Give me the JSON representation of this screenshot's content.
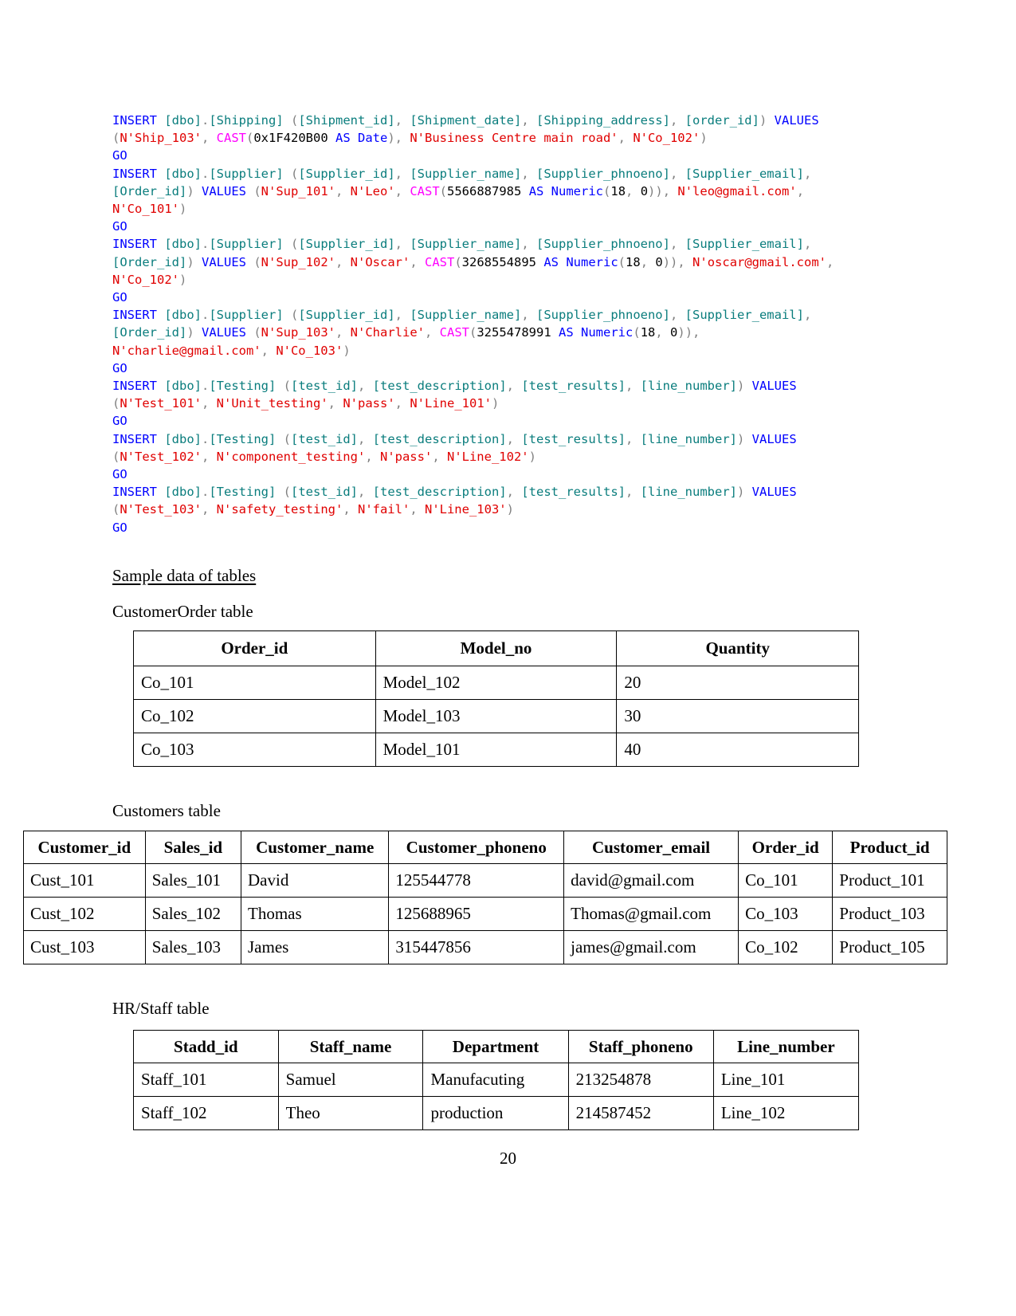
{
  "document": {
    "page_number": "20"
  },
  "sql": {
    "statements": [
      {
        "tokens": [
          {
            "t": "INSERT ",
            "c": "k"
          },
          {
            "t": "[dbo]",
            "c": "id"
          },
          {
            "t": ".",
            "c": "p"
          },
          {
            "t": "[Shipping]",
            "c": "id"
          },
          {
            "t": " (",
            "c": "p"
          },
          {
            "t": "[Shipment_id]",
            "c": "id"
          },
          {
            "t": ", ",
            "c": "p"
          },
          {
            "t": "[Shipment_date]",
            "c": "id"
          },
          {
            "t": ", ",
            "c": "p"
          },
          {
            "t": "[Shipping_address]",
            "c": "id"
          },
          {
            "t": ", ",
            "c": "p"
          },
          {
            "t": "[order_id]",
            "c": "id"
          },
          {
            "t": ") ",
            "c": "p"
          },
          {
            "t": "VALUES",
            "c": "k"
          },
          {
            "t": " (",
            "c": "p"
          },
          {
            "t": "N'Ship_103'",
            "c": "s"
          },
          {
            "t": ", ",
            "c": "p"
          },
          {
            "t": "CAST",
            "c": "f"
          },
          {
            "t": "(",
            "c": "p"
          },
          {
            "t": "0x1F420B00",
            "c": "n"
          },
          {
            "t": " ",
            "c": "p"
          },
          {
            "t": "AS Date",
            "c": "k"
          },
          {
            "t": "), ",
            "c": "p"
          },
          {
            "t": "N'Business Centre main road'",
            "c": "s"
          },
          {
            "t": ", ",
            "c": "p"
          },
          {
            "t": "N'Co_102'",
            "c": "s"
          },
          {
            "t": ")",
            "c": "p"
          }
        ]
      },
      {
        "tokens": [
          {
            "t": "INSERT ",
            "c": "k"
          },
          {
            "t": "[dbo]",
            "c": "id"
          },
          {
            "t": ".",
            "c": "p"
          },
          {
            "t": "[Supplier]",
            "c": "id"
          },
          {
            "t": " (",
            "c": "p"
          },
          {
            "t": "[Supplier_id]",
            "c": "id"
          },
          {
            "t": ", ",
            "c": "p"
          },
          {
            "t": "[Supplier_name]",
            "c": "id"
          },
          {
            "t": ", ",
            "c": "p"
          },
          {
            "t": "[Supplier_phnoeno]",
            "c": "id"
          },
          {
            "t": ", ",
            "c": "p"
          },
          {
            "t": "[Supplier_email]",
            "c": "id"
          },
          {
            "t": ", ",
            "c": "p"
          },
          {
            "t": "[Order_id]",
            "c": "id"
          },
          {
            "t": ") ",
            "c": "p"
          },
          {
            "t": "VALUES",
            "c": "k"
          },
          {
            "t": " (",
            "c": "p"
          },
          {
            "t": "N'Sup_101'",
            "c": "s"
          },
          {
            "t": ", ",
            "c": "p"
          },
          {
            "t": "N'Leo'",
            "c": "s"
          },
          {
            "t": ", ",
            "c": "p"
          },
          {
            "t": "CAST",
            "c": "f"
          },
          {
            "t": "(",
            "c": "p"
          },
          {
            "t": "5566887985",
            "c": "n"
          },
          {
            "t": " ",
            "c": "p"
          },
          {
            "t": "AS Numeric",
            "c": "k"
          },
          {
            "t": "(",
            "c": "p"
          },
          {
            "t": "18",
            "c": "n"
          },
          {
            "t": ", ",
            "c": "p"
          },
          {
            "t": "0",
            "c": "n"
          },
          {
            "t": ")), ",
            "c": "p"
          },
          {
            "t": "N'leo@gmail.com'",
            "c": "s"
          },
          {
            "t": ", ",
            "c": "p"
          },
          {
            "t": "N'Co_101'",
            "c": "s"
          },
          {
            "t": ")",
            "c": "p"
          }
        ]
      },
      {
        "tokens": [
          {
            "t": "INSERT ",
            "c": "k"
          },
          {
            "t": "[dbo]",
            "c": "id"
          },
          {
            "t": ".",
            "c": "p"
          },
          {
            "t": "[Supplier]",
            "c": "id"
          },
          {
            "t": " (",
            "c": "p"
          },
          {
            "t": "[Supplier_id]",
            "c": "id"
          },
          {
            "t": ", ",
            "c": "p"
          },
          {
            "t": "[Supplier_name]",
            "c": "id"
          },
          {
            "t": ", ",
            "c": "p"
          },
          {
            "t": "[Supplier_phnoeno]",
            "c": "id"
          },
          {
            "t": ", ",
            "c": "p"
          },
          {
            "t": "[Supplier_email]",
            "c": "id"
          },
          {
            "t": ", ",
            "c": "p"
          },
          {
            "t": "[Order_id]",
            "c": "id"
          },
          {
            "t": ") ",
            "c": "p"
          },
          {
            "t": "VALUES",
            "c": "k"
          },
          {
            "t": " (",
            "c": "p"
          },
          {
            "t": "N'Sup_102'",
            "c": "s"
          },
          {
            "t": ", ",
            "c": "p"
          },
          {
            "t": "N'Oscar'",
            "c": "s"
          },
          {
            "t": ", ",
            "c": "p"
          },
          {
            "t": "CAST",
            "c": "f"
          },
          {
            "t": "(",
            "c": "p"
          },
          {
            "t": "3268554895",
            "c": "n"
          },
          {
            "t": " ",
            "c": "p"
          },
          {
            "t": "AS Numeric",
            "c": "k"
          },
          {
            "t": "(",
            "c": "p"
          },
          {
            "t": "18",
            "c": "n"
          },
          {
            "t": ", ",
            "c": "p"
          },
          {
            "t": "0",
            "c": "n"
          },
          {
            "t": ")), ",
            "c": "p"
          },
          {
            "t": "N'oscar@gmail.com'",
            "c": "s"
          },
          {
            "t": ", ",
            "c": "p"
          },
          {
            "t": "N'Co_102'",
            "c": "s"
          },
          {
            "t": ")",
            "c": "p"
          }
        ]
      },
      {
        "tokens": [
          {
            "t": "INSERT ",
            "c": "k"
          },
          {
            "t": "[dbo]",
            "c": "id"
          },
          {
            "t": ".",
            "c": "p"
          },
          {
            "t": "[Supplier]",
            "c": "id"
          },
          {
            "t": " (",
            "c": "p"
          },
          {
            "t": "[Supplier_id]",
            "c": "id"
          },
          {
            "t": ", ",
            "c": "p"
          },
          {
            "t": "[Supplier_name]",
            "c": "id"
          },
          {
            "t": ", ",
            "c": "p"
          },
          {
            "t": "[Supplier_phnoeno]",
            "c": "id"
          },
          {
            "t": ", ",
            "c": "p"
          },
          {
            "t": "[Supplier_email]",
            "c": "id"
          },
          {
            "t": ", ",
            "c": "p"
          },
          {
            "t": "[Order_id]",
            "c": "id"
          },
          {
            "t": ") ",
            "c": "p"
          },
          {
            "t": "VALUES",
            "c": "k"
          },
          {
            "t": " (",
            "c": "p"
          },
          {
            "t": "N'Sup_103'",
            "c": "s"
          },
          {
            "t": ", ",
            "c": "p"
          },
          {
            "t": "N'Charlie'",
            "c": "s"
          },
          {
            "t": ", ",
            "c": "p"
          },
          {
            "t": "CAST",
            "c": "f"
          },
          {
            "t": "(",
            "c": "p"
          },
          {
            "t": "3255478991",
            "c": "n"
          },
          {
            "t": " ",
            "c": "p"
          },
          {
            "t": "AS Numeric",
            "c": "k"
          },
          {
            "t": "(",
            "c": "p"
          },
          {
            "t": "18",
            "c": "n"
          },
          {
            "t": ", ",
            "c": "p"
          },
          {
            "t": "0",
            "c": "n"
          },
          {
            "t": ")), ",
            "c": "p"
          },
          {
            "t": "N'charlie@gmail.com'",
            "c": "s"
          },
          {
            "t": ", ",
            "c": "p"
          },
          {
            "t": "N'Co_103'",
            "c": "s"
          },
          {
            "t": ")",
            "c": "p"
          }
        ]
      },
      {
        "tokens": [
          {
            "t": "INSERT ",
            "c": "k"
          },
          {
            "t": "[dbo]",
            "c": "id"
          },
          {
            "t": ".",
            "c": "p"
          },
          {
            "t": "[Testing]",
            "c": "id"
          },
          {
            "t": " (",
            "c": "p"
          },
          {
            "t": "[test_id]",
            "c": "id"
          },
          {
            "t": ", ",
            "c": "p"
          },
          {
            "t": "[test_description]",
            "c": "id"
          },
          {
            "t": ", ",
            "c": "p"
          },
          {
            "t": "[test_results]",
            "c": "id"
          },
          {
            "t": ", ",
            "c": "p"
          },
          {
            "t": "[line_number]",
            "c": "id"
          },
          {
            "t": ") ",
            "c": "p"
          },
          {
            "t": "VALUES",
            "c": "k"
          },
          {
            "t": " (",
            "c": "p"
          },
          {
            "t": "N'Test_101'",
            "c": "s"
          },
          {
            "t": ", ",
            "c": "p"
          },
          {
            "t": "N'Unit_testing'",
            "c": "s"
          },
          {
            "t": ", ",
            "c": "p"
          },
          {
            "t": "N'pass'",
            "c": "s"
          },
          {
            "t": ", ",
            "c": "p"
          },
          {
            "t": "N'Line_101'",
            "c": "s"
          },
          {
            "t": ")",
            "c": "p"
          }
        ]
      },
      {
        "tokens": [
          {
            "t": "INSERT ",
            "c": "k"
          },
          {
            "t": "[dbo]",
            "c": "id"
          },
          {
            "t": ".",
            "c": "p"
          },
          {
            "t": "[Testing]",
            "c": "id"
          },
          {
            "t": " (",
            "c": "p"
          },
          {
            "t": "[test_id]",
            "c": "id"
          },
          {
            "t": ", ",
            "c": "p"
          },
          {
            "t": "[test_description]",
            "c": "id"
          },
          {
            "t": ", ",
            "c": "p"
          },
          {
            "t": "[test_results]",
            "c": "id"
          },
          {
            "t": ", ",
            "c": "p"
          },
          {
            "t": "[line_number]",
            "c": "id"
          },
          {
            "t": ") ",
            "c": "p"
          },
          {
            "t": "VALUES",
            "c": "k"
          },
          {
            "t": " (",
            "c": "p"
          },
          {
            "t": "N'Test_102'",
            "c": "s"
          },
          {
            "t": ", ",
            "c": "p"
          },
          {
            "t": "N'component_testing'",
            "c": "s"
          },
          {
            "t": ", ",
            "c": "p"
          },
          {
            "t": "N'pass'",
            "c": "s"
          },
          {
            "t": ", ",
            "c": "p"
          },
          {
            "t": "N'Line_102'",
            "c": "s"
          },
          {
            "t": ")",
            "c": "p"
          }
        ]
      },
      {
        "tokens": [
          {
            "t": "INSERT ",
            "c": "k"
          },
          {
            "t": "[dbo]",
            "c": "id"
          },
          {
            "t": ".",
            "c": "p"
          },
          {
            "t": "[Testing]",
            "c": "id"
          },
          {
            "t": " (",
            "c": "p"
          },
          {
            "t": "[test_id]",
            "c": "id"
          },
          {
            "t": ", ",
            "c": "p"
          },
          {
            "t": "[test_description]",
            "c": "id"
          },
          {
            "t": ", ",
            "c": "p"
          },
          {
            "t": "[test_results]",
            "c": "id"
          },
          {
            "t": ", ",
            "c": "p"
          },
          {
            "t": "[line_number]",
            "c": "id"
          },
          {
            "t": ") ",
            "c": "p"
          },
          {
            "t": "VALUES",
            "c": "k"
          },
          {
            "t": " (",
            "c": "p"
          },
          {
            "t": "N'Test_103'",
            "c": "s"
          },
          {
            "t": ", ",
            "c": "p"
          },
          {
            "t": "N'safety_testing'",
            "c": "s"
          },
          {
            "t": ", ",
            "c": "p"
          },
          {
            "t": "N'fail'",
            "c": "s"
          },
          {
            "t": ", ",
            "c": "p"
          },
          {
            "t": "N'Line_103'",
            "c": "s"
          },
          {
            "t": ")",
            "c": "p"
          }
        ]
      }
    ],
    "go_label": "GO"
  },
  "sections": {
    "sample_data_heading": "Sample data of tables",
    "customerorder_caption": "CustomerOrder table",
    "customers_caption": "Customers table",
    "staff_caption": "HR/Staff table"
  },
  "customerorder_table": {
    "headers": [
      "Order_id",
      "Model_no",
      "Quantity"
    ],
    "rows": [
      [
        "Co_101",
        "Model_102",
        "20"
      ],
      [
        "Co_102",
        "Model_103",
        "30"
      ],
      [
        "Co_103",
        "Model_101",
        "40"
      ]
    ]
  },
  "customers_table": {
    "headers": [
      "Customer_id",
      "Sales_id",
      "Customer_name",
      "Customer_phoneno",
      "Customer_email",
      "Order_id",
      "Product_id"
    ],
    "rows": [
      [
        "Cust_101",
        "Sales_101",
        "David",
        "125544778",
        "david@gmail.com",
        "Co_101",
        "Product_101"
      ],
      [
        "Cust_102",
        "Sales_102",
        "Thomas",
        "125688965",
        "Thomas@gmail.com",
        "Co_103",
        "Product_103"
      ],
      [
        "Cust_103",
        "Sales_103",
        "James",
        "315447856",
        "james@gmail.com",
        "Co_102",
        "Product_105"
      ]
    ]
  },
  "staff_table": {
    "headers": [
      "Stadd_id",
      "Staff_name",
      "Department",
      "Staff_phoneno",
      "Line_number"
    ],
    "rows": [
      [
        "Staff_101",
        "Samuel",
        "Manufacuting",
        "213254878",
        "Line_101"
      ],
      [
        "Staff_102",
        "Theo",
        "production",
        "214587452",
        "Line_102"
      ]
    ]
  }
}
